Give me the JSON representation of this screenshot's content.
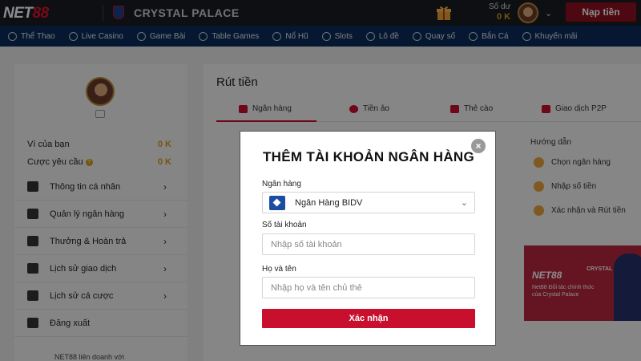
{
  "header": {
    "logo_prefix": "NET",
    "logo_suffix": "88",
    "club_name": "CRYSTAL PALACE",
    "balance_label": "Số dư",
    "balance_value": "0 K",
    "deposit_label": "Nạp tiền"
  },
  "nav": {
    "items": [
      {
        "label": "Thể Thao",
        "icon": "soccer-icon"
      },
      {
        "label": "Live Casino",
        "icon": "casino-icon"
      },
      {
        "label": "Game Bài",
        "icon": "cards-icon"
      },
      {
        "label": "Table Games",
        "icon": "table-icon"
      },
      {
        "label": "Nổ Hũ",
        "icon": "jackpot-icon"
      },
      {
        "label": "Slots",
        "icon": "slots-icon"
      },
      {
        "label": "Lô đề",
        "icon": "lottery-icon"
      },
      {
        "label": "Quay số",
        "icon": "draw-icon"
      },
      {
        "label": "Bắn Cá",
        "icon": "fish-icon"
      },
      {
        "label": "Khuyến mãi",
        "icon": "promo-icon"
      }
    ]
  },
  "sidebar": {
    "wallet_label": "Ví của bạn",
    "wallet_value": "0 K",
    "bet_label": "Cược yêu cầu",
    "bet_value": "0 K",
    "menu": [
      {
        "label": "Thông tin cá nhân"
      },
      {
        "label": "Quản lý ngân hàng"
      },
      {
        "label": "Thưởng & Hoàn trả"
      },
      {
        "label": "Lịch sử giao dịch"
      },
      {
        "label": "Lịch sử cá cược"
      },
      {
        "label": "Đăng xuất"
      }
    ],
    "footer_text": "NET88 liên doanh với"
  },
  "main": {
    "title": "Rút tiền",
    "tabs": [
      {
        "label": "Ngân hàng"
      },
      {
        "label": "Tiền ảo"
      },
      {
        "label": "Thẻ cào"
      },
      {
        "label": "Giao dịch P2P"
      }
    ],
    "guide": {
      "title": "Hướng dẫn",
      "steps": [
        "Chọn ngân hàng",
        "Nhập số tiền",
        "Xác nhận và Rút tiền"
      ]
    },
    "banner": {
      "logo": "NET88",
      "club": "CRYSTAL PALACE",
      "text": "Net88 Đối tác chính thức của Crystal Palace"
    }
  },
  "modal": {
    "close": "×",
    "title": "THÊM TÀI KHOẢN NGÂN HÀNG",
    "bank_label": "Ngân hàng",
    "bank_value": "Ngân Hàng BIDV",
    "account_label": "Số tài khoản",
    "account_placeholder": "Nhập số tài khoản",
    "name_label": "Họ và tên",
    "name_placeholder": "Nhập họ và tên chủ thẻ",
    "confirm_label": "Xác nhận"
  }
}
